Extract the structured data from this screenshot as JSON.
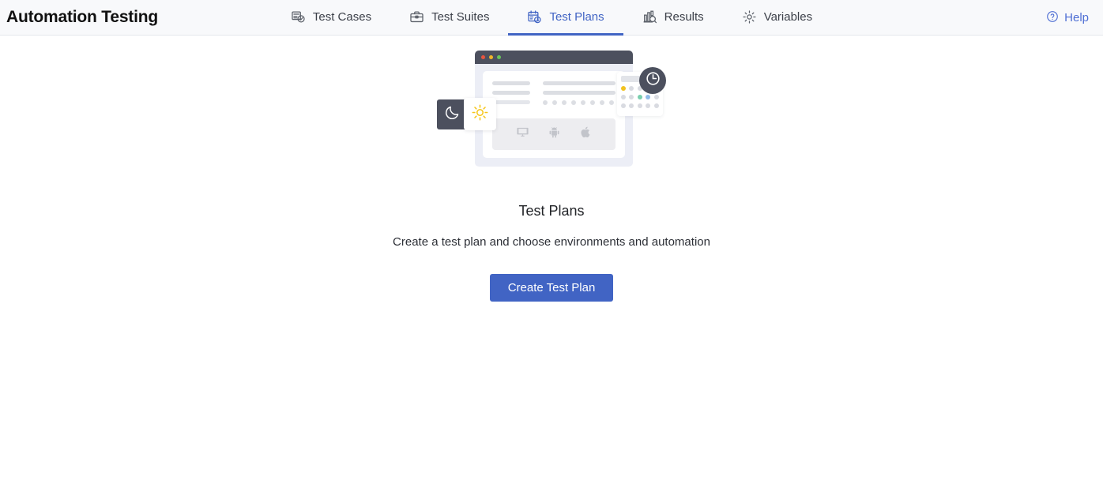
{
  "header": {
    "title": "Automation Testing",
    "tabs": [
      {
        "label": "Test Cases",
        "icon": "list-check-icon",
        "active": false
      },
      {
        "label": "Test Suites",
        "icon": "briefcase-icon",
        "active": false
      },
      {
        "label": "Test Plans",
        "icon": "calendar-clock-icon",
        "active": true
      },
      {
        "label": "Results",
        "icon": "bar-chart-search-icon",
        "active": false
      },
      {
        "label": "Variables",
        "icon": "gear-icon",
        "active": false
      }
    ],
    "help": {
      "label": "Help",
      "icon": "question-circle-icon"
    },
    "accent_color": "#4164c4",
    "link_color": "#4f6fd4",
    "background": "#f8f9fb"
  },
  "empty_state": {
    "illustration": {
      "name": "test-plans-illustration",
      "browser_dots": [
        "#e8553f",
        "#f0b429",
        "#68c45b"
      ],
      "devices": [
        "monitor-icon",
        "android-icon",
        "apple-icon"
      ],
      "calendar": {
        "rows": [
          [
            "gold",
            "gray",
            "gray",
            "gray",
            "gray"
          ],
          [
            "gray",
            "gray",
            "green",
            "blue",
            "gray"
          ],
          [
            "gray",
            "gray",
            "gray",
            "gray",
            "gray"
          ]
        ],
        "colors": {
          "gold": "#f2c21f",
          "green": "#79cfae",
          "blue": "#8fbbe8",
          "gray": "#d9dbe1"
        }
      },
      "badges": [
        "clock-icon",
        "moon-icon",
        "sun-icon"
      ]
    },
    "title": "Test Plans",
    "subtitle": "Create a test plan and choose environments and automation",
    "cta_label": "Create Test Plan",
    "cta_color": "#4164c4"
  }
}
